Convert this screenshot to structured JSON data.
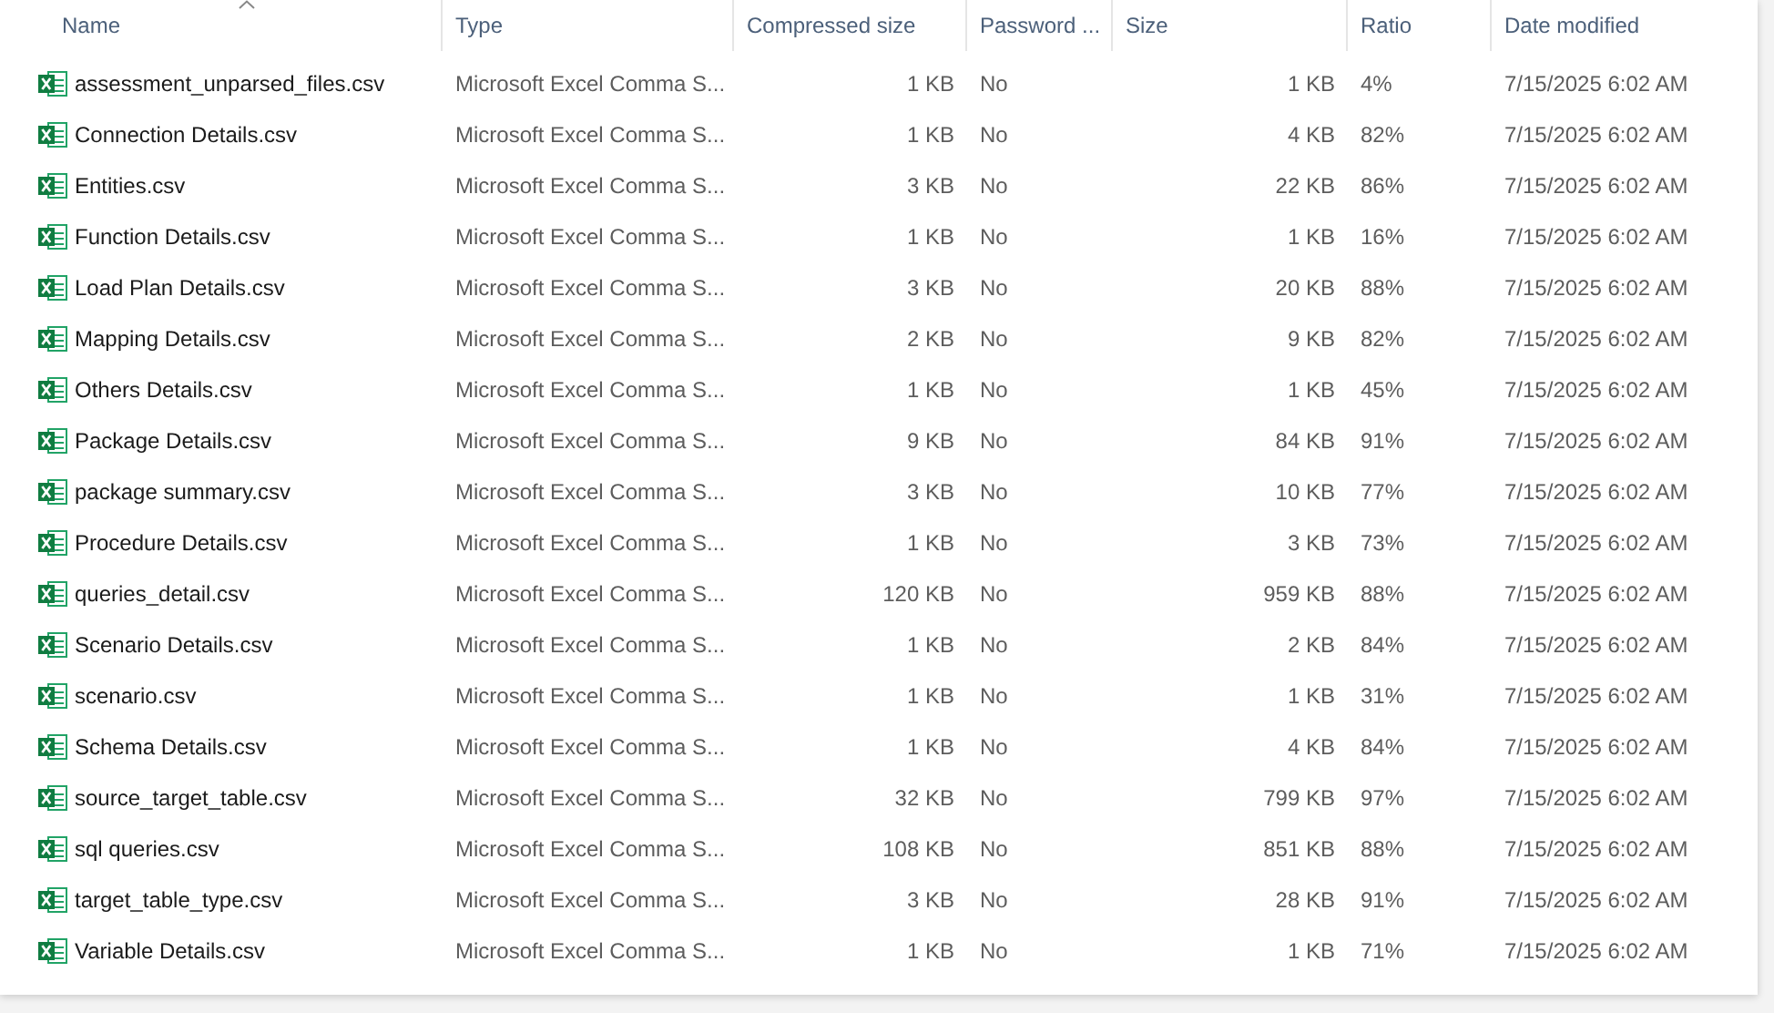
{
  "table": {
    "columns": [
      {
        "label": "Name",
        "sorted": true
      },
      {
        "label": "Type",
        "sorted": false
      },
      {
        "label": "Compressed size",
        "sorted": false
      },
      {
        "label": "Password ...",
        "sorted": false
      },
      {
        "label": "Size",
        "sorted": false
      },
      {
        "label": "Ratio",
        "sorted": false
      },
      {
        "label": "Date modified",
        "sorted": false
      }
    ],
    "rows": [
      [
        "assessment_unparsed_files.csv",
        "Microsoft Excel Comma S...",
        "1 KB",
        "No",
        "1 KB",
        "4%",
        "7/15/2025 6:02 AM"
      ],
      [
        "Connection Details.csv",
        "Microsoft Excel Comma S...",
        "1 KB",
        "No",
        "4 KB",
        "82%",
        "7/15/2025 6:02 AM"
      ],
      [
        "Entities.csv",
        "Microsoft Excel Comma S...",
        "3 KB",
        "No",
        "22 KB",
        "86%",
        "7/15/2025 6:02 AM"
      ],
      [
        "Function Details.csv",
        "Microsoft Excel Comma S...",
        "1 KB",
        "No",
        "1 KB",
        "16%",
        "7/15/2025 6:02 AM"
      ],
      [
        "Load Plan Details.csv",
        "Microsoft Excel Comma S...",
        "3 KB",
        "No",
        "20 KB",
        "88%",
        "7/15/2025 6:02 AM"
      ],
      [
        "Mapping Details.csv",
        "Microsoft Excel Comma S...",
        "2 KB",
        "No",
        "9 KB",
        "82%",
        "7/15/2025 6:02 AM"
      ],
      [
        "Others Details.csv",
        "Microsoft Excel Comma S...",
        "1 KB",
        "No",
        "1 KB",
        "45%",
        "7/15/2025 6:02 AM"
      ],
      [
        "Package Details.csv",
        "Microsoft Excel Comma S...",
        "9 KB",
        "No",
        "84 KB",
        "91%",
        "7/15/2025 6:02 AM"
      ],
      [
        "package summary.csv",
        "Microsoft Excel Comma S...",
        "3 KB",
        "No",
        "10 KB",
        "77%",
        "7/15/2025 6:02 AM"
      ],
      [
        "Procedure Details.csv",
        "Microsoft Excel Comma S...",
        "1 KB",
        "No",
        "3 KB",
        "73%",
        "7/15/2025 6:02 AM"
      ],
      [
        "queries_detail.csv",
        "Microsoft Excel Comma S...",
        "120 KB",
        "No",
        "959 KB",
        "88%",
        "7/15/2025 6:02 AM"
      ],
      [
        "Scenario Details.csv",
        "Microsoft Excel Comma S...",
        "1 KB",
        "No",
        "2 KB",
        "84%",
        "7/15/2025 6:02 AM"
      ],
      [
        "scenario.csv",
        "Microsoft Excel Comma S...",
        "1 KB",
        "No",
        "1 KB",
        "31%",
        "7/15/2025 6:02 AM"
      ],
      [
        "Schema Details.csv",
        "Microsoft Excel Comma S...",
        "1 KB",
        "No",
        "4 KB",
        "84%",
        "7/15/2025 6:02 AM"
      ],
      [
        "source_target_table.csv",
        "Microsoft Excel Comma S...",
        "32 KB",
        "No",
        "799 KB",
        "97%",
        "7/15/2025 6:02 AM"
      ],
      [
        "sql queries.csv",
        "Microsoft Excel Comma S...",
        "108 KB",
        "No",
        "851 KB",
        "88%",
        "7/15/2025 6:02 AM"
      ],
      [
        "target_table_type.csv",
        "Microsoft Excel Comma S...",
        "3 KB",
        "No",
        "28 KB",
        "91%",
        "7/15/2025 6:02 AM"
      ],
      [
        "Variable Details.csv",
        "Microsoft Excel Comma S...",
        "1 KB",
        "No",
        "1 KB",
        "71%",
        "7/15/2025 6:02 AM"
      ]
    ]
  }
}
